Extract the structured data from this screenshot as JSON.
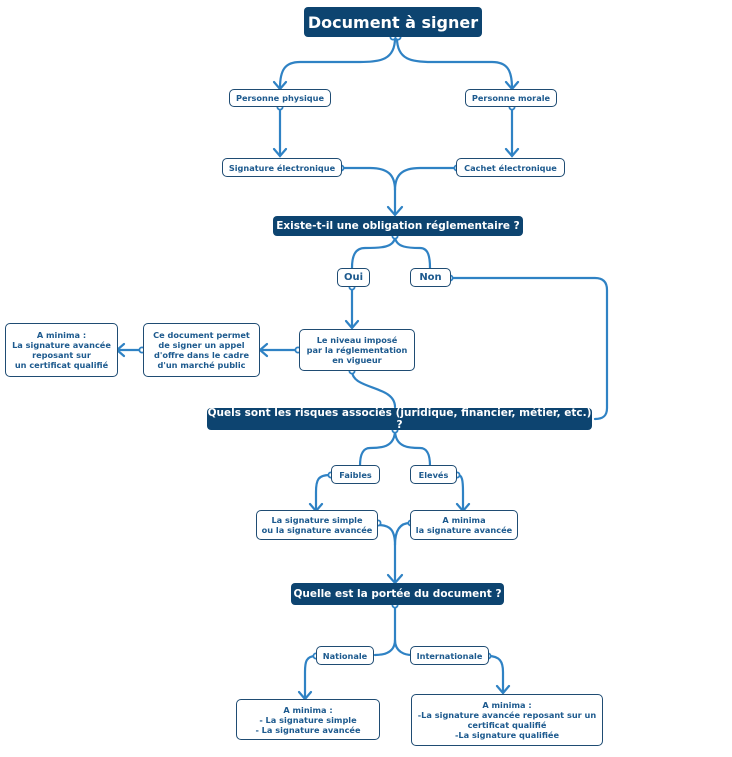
{
  "diagram": {
    "title": "Document à signer",
    "colors": {
      "header_bg": "#0d4470",
      "box_text": "#1d5a8e",
      "box_border": "#1f4c73",
      "connector": "#2f82c4"
    },
    "nodes": {
      "personne_physique": "Personne physique",
      "personne_morale": "Personne morale",
      "signature_electronique": "Signature électronique",
      "cachet_electronique": "Cachet électronique",
      "q_obligation": "Existe-t-il une obligation réglementaire ?",
      "oui": "Oui",
      "non": "Non",
      "niveau_impose": "Le niveau imposé\npar la réglementation\nen vigueur",
      "marche_public": "Ce document permet\nde signer un appel\nd'offre dans le cadre\nd'un marché public",
      "a_minima_qualifie": "A minima :\nLa signature avancée\nreposant sur\nun certificat qualifié",
      "q_risques": "Quels sont les risques associés (juridique, financier, métier, etc.) ?",
      "faibles": "Faibles",
      "eleves": "Elevés",
      "simple_ou_avancee": "La signature simple\nou la signature avancée",
      "a_minima_avancee": "A minima\nla signature avancée",
      "q_portee": "Quelle est la portée du document ?",
      "nationale": "Nationale",
      "internationale": "Internationale",
      "res_nationale": "A minima :\n- La signature simple\n-  La signature avancée",
      "res_internationale": "A minima :\n-La signature avancée reposant sur un\ncertificat qualifié\n-La signature qualifiée"
    }
  }
}
